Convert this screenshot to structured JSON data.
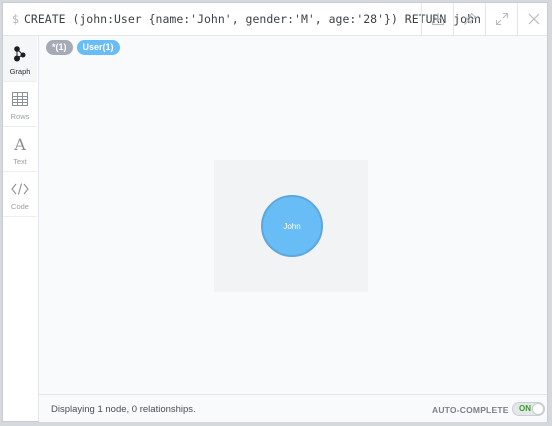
{
  "editor": {
    "prompt": "$",
    "query": "CREATE (john:User {name:'John', gender:'M', age:'28'}) RETURN john"
  },
  "toolbar": {
    "buttons": [
      {
        "icon": "download-icon"
      },
      {
        "icon": "pin-icon"
      },
      {
        "icon": "expand-icon"
      },
      {
        "icon": "close-icon"
      }
    ]
  },
  "sidebar": {
    "items": [
      {
        "label": "Graph",
        "icon": "graph-icon",
        "active": true
      },
      {
        "label": "Rows",
        "icon": "table-icon",
        "active": false
      },
      {
        "label": "Text",
        "icon": "text-icon",
        "active": false
      },
      {
        "label": "Code",
        "icon": "code-icon",
        "active": false
      }
    ]
  },
  "filters": {
    "all_label": "*(1)",
    "user_label": "User(1)"
  },
  "graph": {
    "node_label": "John",
    "node_color": "#68bdf6"
  },
  "footer": {
    "status": "Displaying 1 node, 0 relationships.",
    "autocomplete_label": "AUTO-COMPLETE",
    "toggle_label": "ON"
  }
}
